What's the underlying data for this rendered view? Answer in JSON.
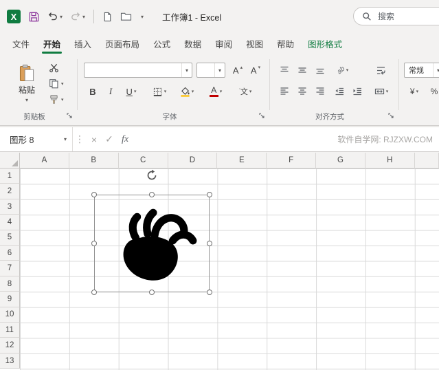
{
  "titlebar": {
    "title": "工作簿1 - Excel",
    "search_label": "搜索"
  },
  "icons": {
    "excel_logo": "X",
    "dropdown": "▾",
    "splitter_dots": "⋮"
  },
  "ribbon": {
    "tabs": [
      {
        "label": "文件"
      },
      {
        "label": "开始"
      },
      {
        "label": "插入"
      },
      {
        "label": "页面布局"
      },
      {
        "label": "公式"
      },
      {
        "label": "数据"
      },
      {
        "label": "审阅"
      },
      {
        "label": "视图"
      },
      {
        "label": "帮助"
      },
      {
        "label": "图形格式"
      }
    ],
    "active_tab": "开始",
    "contextual_tab": "图形格式",
    "clipboard": {
      "group_label": "剪贴板",
      "paste_label": "粘贴"
    },
    "font": {
      "group_label": "字体",
      "font_name_value": "",
      "font_size_value": "",
      "bold": "B",
      "italic": "I",
      "underline": "U",
      "grow_label": "A",
      "shrink_label": "A",
      "grow_mark": "▴",
      "shrink_mark": "▾",
      "font_color_letter": "A",
      "phonetic": "文",
      "phonetic_mark": "ˊ"
    },
    "alignment": {
      "group_label": "对齐方式",
      "orientation_label": "ab"
    },
    "number": {
      "format_value": "常规",
      "currency": "¥",
      "percent": "%"
    }
  },
  "formula_bar": {
    "name_box_value": "图形 8",
    "cancel": "×",
    "enter": "✓",
    "fx": "fx",
    "watermark": "软件自学网: RJZXW.COM"
  },
  "grid": {
    "column_headers": [
      "A",
      "B",
      "C",
      "D",
      "E",
      "F",
      "G",
      "H"
    ],
    "row_headers": [
      "1",
      "2",
      "3",
      "4",
      "5",
      "6",
      "7",
      "8",
      "9",
      "10",
      "11",
      "12",
      "13"
    ],
    "selected_shape": {
      "name": "图形 8",
      "type": "anatomical-heart",
      "fill": "#000000"
    }
  },
  "colors": {
    "excel_green": "#107c41",
    "font_color_bar": "#c00000",
    "fill_color_bar": "#ffc000",
    "save_icon": "#8e3a9e"
  }
}
